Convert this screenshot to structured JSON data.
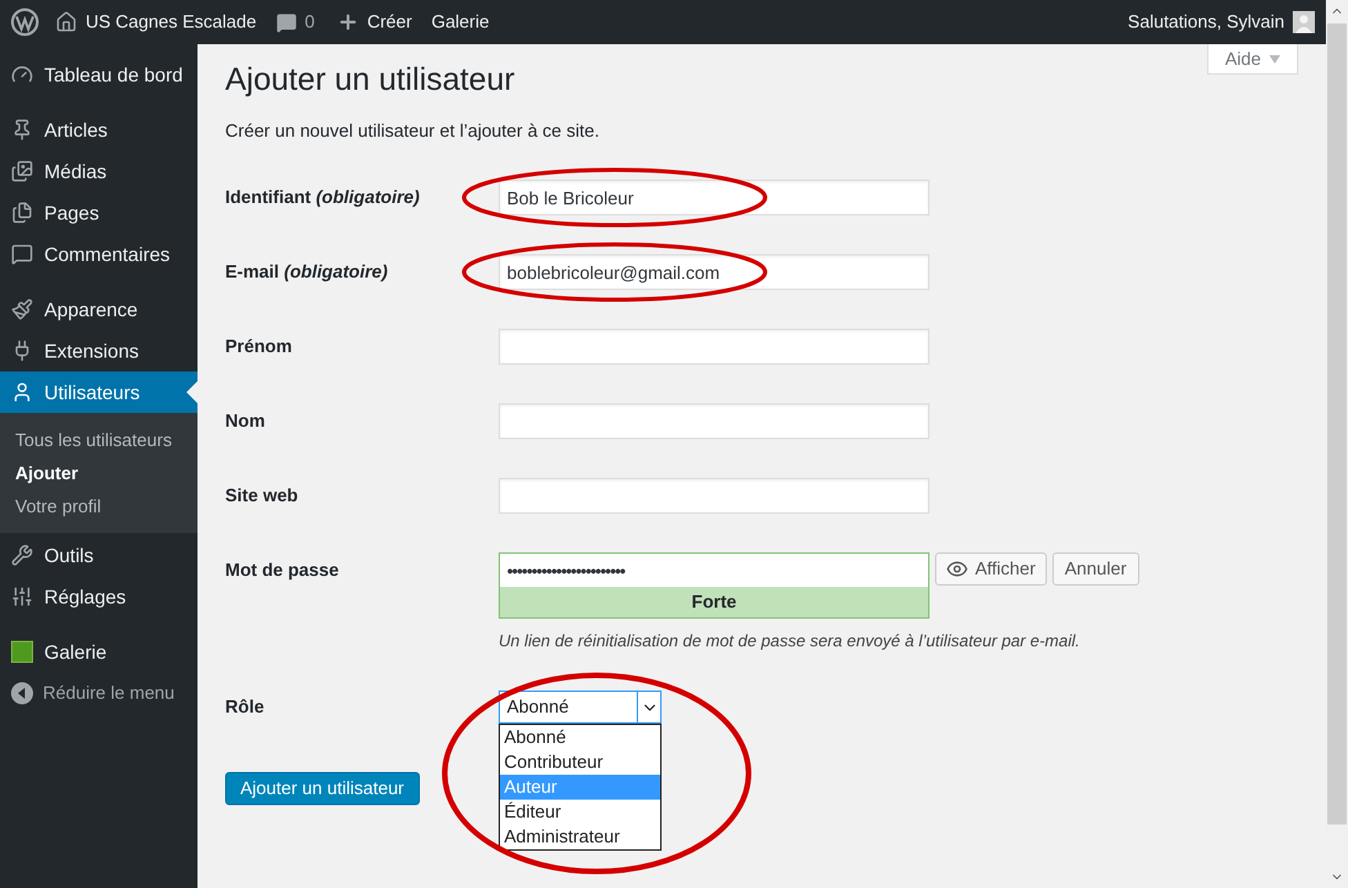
{
  "top_bar": {
    "site_name": "US Cagnes Escalade",
    "comments_count": "0",
    "new_label": "Créer",
    "gallery_label": "Galerie",
    "greeting": "Salutations, Sylvain"
  },
  "help_tab": {
    "label": "Aide"
  },
  "sidebar": {
    "groups": [
      [
        {
          "label": "Tableau de bord",
          "selected": false
        }
      ],
      [
        {
          "label": "Articles",
          "selected": false
        },
        {
          "label": "Médias",
          "selected": false
        },
        {
          "label": "Pages",
          "selected": false
        },
        {
          "label": "Commentaires",
          "selected": false
        }
      ],
      [
        {
          "label": "Apparence",
          "selected": false
        },
        {
          "label": "Extensions",
          "selected": false
        },
        {
          "label": "Utilisateurs",
          "selected": true,
          "children": [
            {
              "label": "Tous les utilisateurs",
              "selected": false
            },
            {
              "label": "Ajouter",
              "selected": true
            },
            {
              "label": "Votre profil",
              "selected": false
            }
          ]
        },
        {
          "label": "Outils",
          "selected": false
        },
        {
          "label": "Réglages",
          "selected": false
        }
      ],
      [
        {
          "label": "Galerie",
          "selected": false
        }
      ]
    ],
    "collapse_label": "Réduire le menu"
  },
  "page": {
    "title": "Ajouter un utilisateur",
    "subtitle": "Créer un nouvel utilisateur et l’ajouter à ce site."
  },
  "form": {
    "fields": [
      {
        "label": "Identifiant *(obligatoire)*",
        "value": "Bob le Bricoleur",
        "circled": true
      },
      {
        "label": "E-mail *(obligatoire)*",
        "value": "boblebricoleur@gmail.com",
        "circled": true
      },
      {
        "label": "Prénom",
        "circled": false
      },
      {
        "label": "Nom",
        "circled": false
      },
      {
        "label": "Site web",
        "circled": false
      }
    ],
    "password": {
      "label": "Mot de passe",
      "value": "••••••••••••••••••••••••",
      "strength": "Forte",
      "show_button": "Afficher",
      "cancel_button": "Annuler",
      "hint": "Un lien de réinitialisation de mot de passe sera envoyé à l’utilisateur par e-mail."
    },
    "role": {
      "label": "Rôle",
      "value": "Abonné",
      "expanded": true,
      "circled": true,
      "options": [
        {
          "label": "Abonné",
          "highlighted": false
        },
        {
          "label": "Contributeur",
          "highlighted": false
        },
        {
          "label": "Auteur",
          "highlighted": true
        },
        {
          "label": "Éditeur",
          "highlighted": false
        },
        {
          "label": "Administrateur",
          "highlighted": false
        }
      ]
    },
    "submit": "Ajouter un utilisateur"
  }
}
